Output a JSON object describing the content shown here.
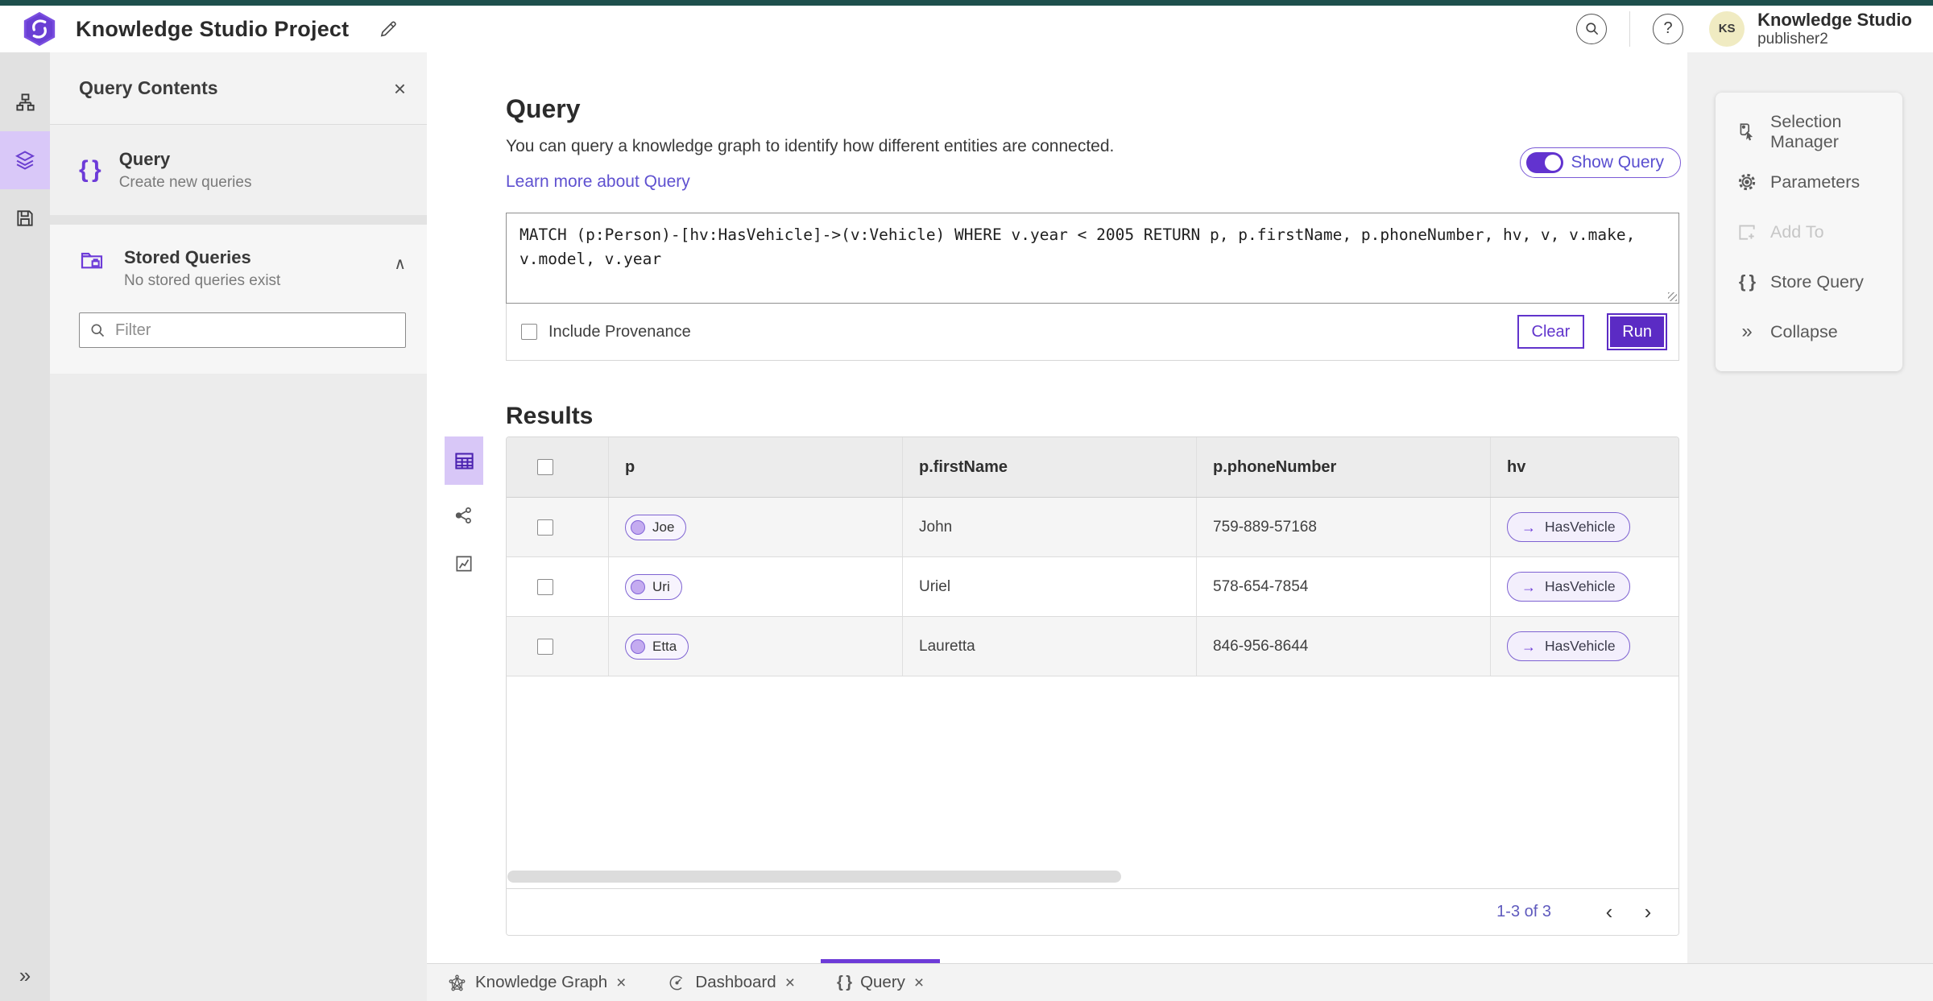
{
  "icons": {
    "close": "×",
    "chevron_up": "∧",
    "collapse": "»",
    "expand": "»",
    "braces": "{ }",
    "arrow_right": "→",
    "prev": "‹",
    "next": "›",
    "help": "?"
  },
  "header": {
    "app_title": "Knowledge Studio Project",
    "user_name": "Knowledge Studio",
    "user_role": "publisher2",
    "avatar_initials": "KS"
  },
  "left_panel": {
    "title": "Query Contents",
    "query_item": {
      "label": "Query",
      "sublabel": "Create new queries"
    },
    "stored_item": {
      "label": "Stored Queries",
      "sublabel": "No stored queries exist"
    },
    "filter_placeholder": "Filter"
  },
  "query_section": {
    "title": "Query",
    "description": "You can query a knowledge graph to identify how different entities are connected.",
    "learn_more": "Learn more about Query",
    "show_query_label": "Show Query",
    "query_text": "MATCH (p:Person)-[hv:HasVehicle]->(v:Vehicle) WHERE v.year < 2005 RETURN p, p.firstName, p.phoneNumber, hv, v, v.make, v.model, v.year",
    "include_provenance": "Include Provenance",
    "clear_label": "Clear",
    "run_label": "Run"
  },
  "results": {
    "title": "Results",
    "columns": [
      "p",
      "p.firstName",
      "p.phoneNumber",
      "hv"
    ],
    "rows": [
      {
        "p": "Joe",
        "firstName": "John",
        "phoneNumber": "759-889-57168",
        "hv": "HasVehicle"
      },
      {
        "p": "Uri",
        "firstName": "Uriel",
        "phoneNumber": "578-654-7854",
        "hv": "HasVehicle"
      },
      {
        "p": "Etta",
        "firstName": "Lauretta",
        "phoneNumber": "846-956-8644",
        "hv": "HasVehicle"
      }
    ],
    "pagination": "1-3 of 3"
  },
  "tools_panel": {
    "selection_manager": "Selection Manager",
    "parameters": "Parameters",
    "add_to": "Add To",
    "store_query": "Store Query",
    "collapse": "Collapse"
  },
  "tabs": {
    "knowledge_graph": "Knowledge Graph",
    "dashboard": "Dashboard",
    "query": "Query"
  },
  "colors": {
    "top_strip": "#1d4f4c",
    "accent_purple": "#5b2bc4",
    "pill_border": "#7e62d2",
    "pill_bg": "#f4f0fc",
    "link": "#5f51d0"
  }
}
